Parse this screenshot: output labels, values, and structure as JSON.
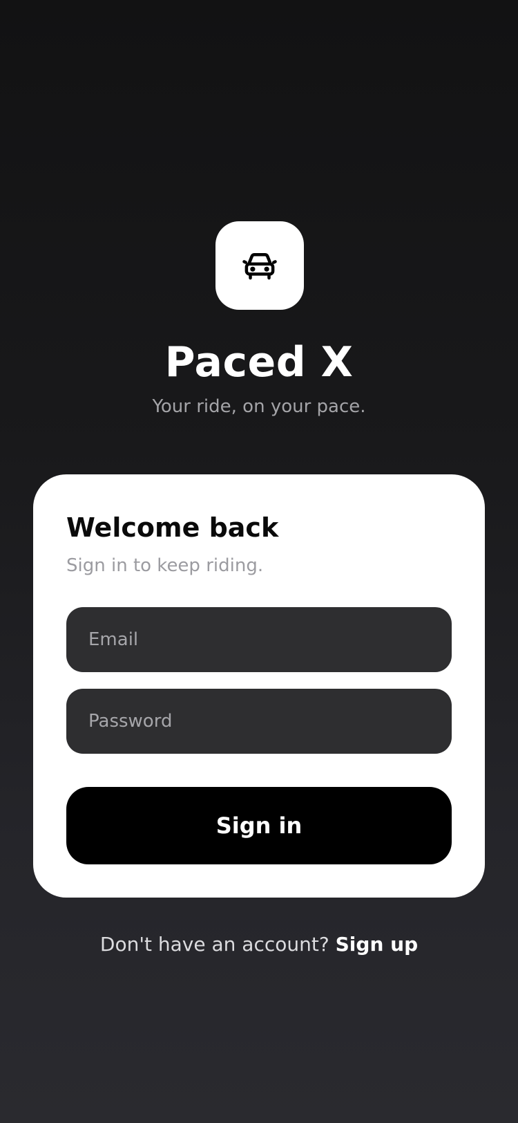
{
  "brand": {
    "logo_icon": "car-icon",
    "title": "Paced X",
    "tagline": "Your ride, on your pace."
  },
  "login_card": {
    "title": "Welcome back",
    "subtitle": "Sign in to keep riding.",
    "email": {
      "placeholder": "Email",
      "value": ""
    },
    "password": {
      "placeholder": "Password",
      "value": ""
    },
    "submit_label": "Sign in"
  },
  "footer": {
    "prompt": "Don't have an account?",
    "signup_label": "Sign up"
  },
  "colors": {
    "background_top": "#121213",
    "background_bottom": "#2a2a2f",
    "card": "#ffffff",
    "field": "#2e2e30",
    "button": "#000000"
  }
}
